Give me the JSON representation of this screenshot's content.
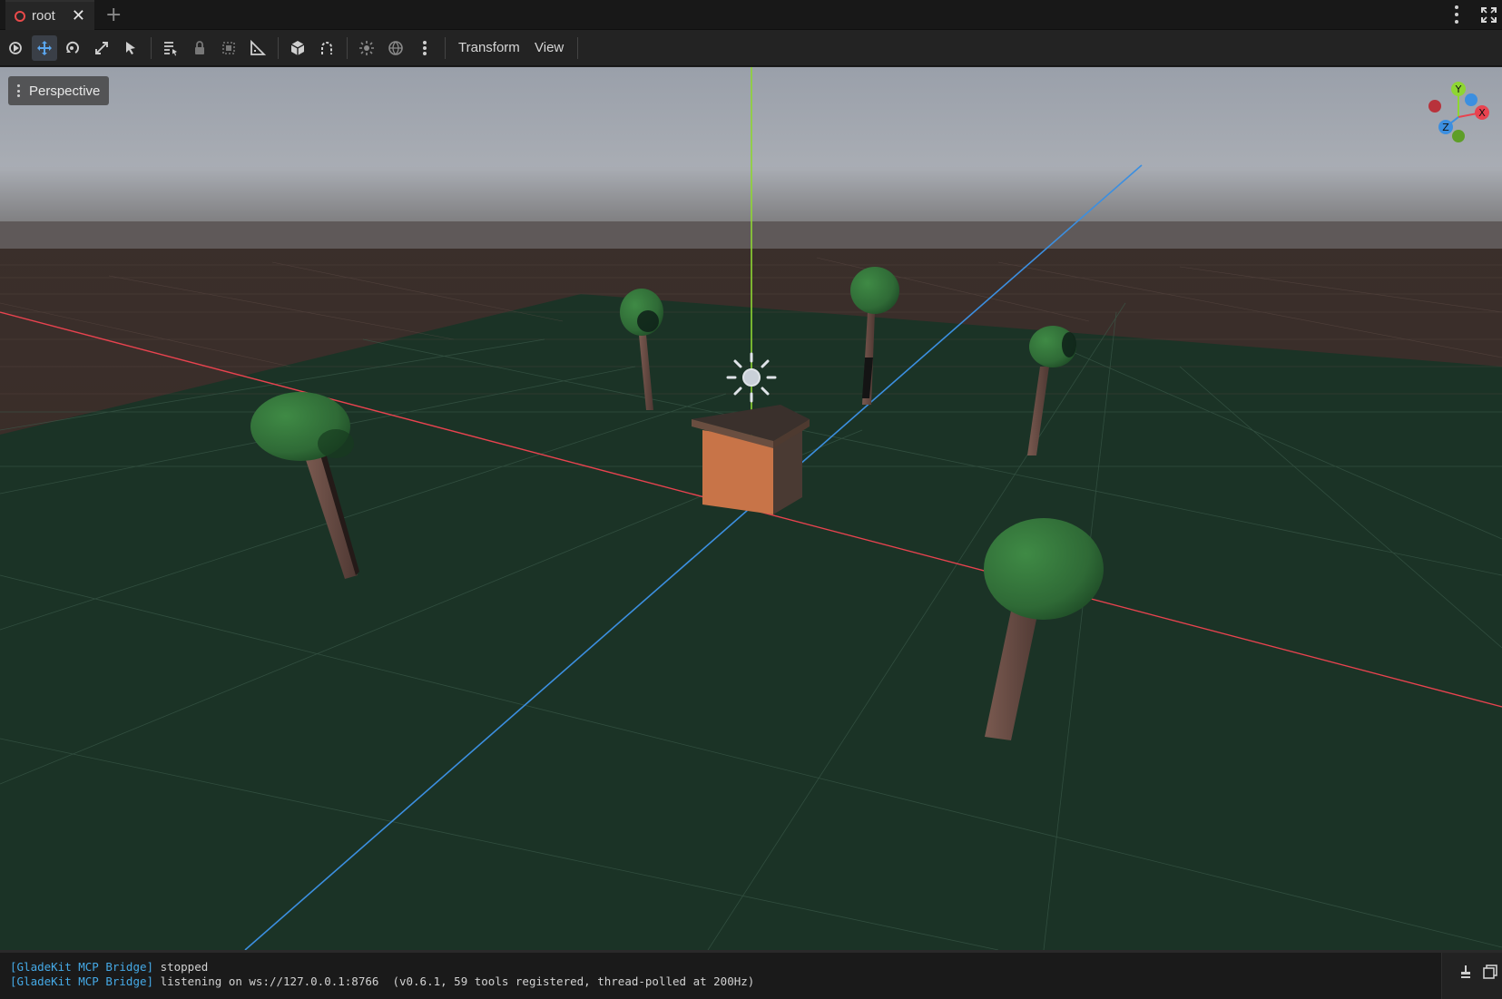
{
  "tabs": [
    {
      "label": "root",
      "icon": "scene-circle-icon",
      "close": "✕"
    }
  ],
  "tab_add": "+",
  "toolbar": {
    "buttons": [
      {
        "name": "select-mode-icon",
        "active": false
      },
      {
        "name": "move-mode-icon",
        "active": true
      },
      {
        "name": "rotate-mode-icon",
        "active": false
      },
      {
        "name": "scale-mode-icon",
        "active": false
      },
      {
        "name": "list-select-icon",
        "active": false
      },
      {
        "name": "list-icon",
        "active": false
      },
      {
        "name": "lock-icon",
        "active": false
      },
      {
        "name": "group-icon",
        "active": false
      },
      {
        "name": "ruler-icon",
        "active": false
      },
      {
        "name": "local-space-icon",
        "active": false
      },
      {
        "name": "snap-icon",
        "active": false
      },
      {
        "name": "sun-preview-icon",
        "active": false
      },
      {
        "name": "environment-preview-icon",
        "active": false
      },
      {
        "name": "more-options-icon",
        "active": false
      }
    ],
    "menus": {
      "transform": "Transform",
      "view": "View"
    }
  },
  "viewport": {
    "mode_label": "Perspective",
    "gizmo": {
      "y": "Y",
      "x": "X",
      "z": "Z"
    },
    "colors": {
      "x_axis": "#e8434f",
      "y_axis": "#8ed632",
      "z_axis": "#3c8fe0",
      "ground": "#1a3226",
      "sky": "#a4a9b2",
      "canopy": "#2f6a36",
      "trunk": "#6a4e46",
      "box": "#c87448"
    }
  },
  "output": {
    "lines": [
      {
        "tag": "[GladeKit MCP Bridge]",
        "text": " stopped"
      },
      {
        "tag": "[GladeKit MCP Bridge]",
        "text": " listening on ws://127.0.0.1:8766  (v0.6.1, 59 tools registered, thread-polled at 200Hz)"
      }
    ]
  }
}
